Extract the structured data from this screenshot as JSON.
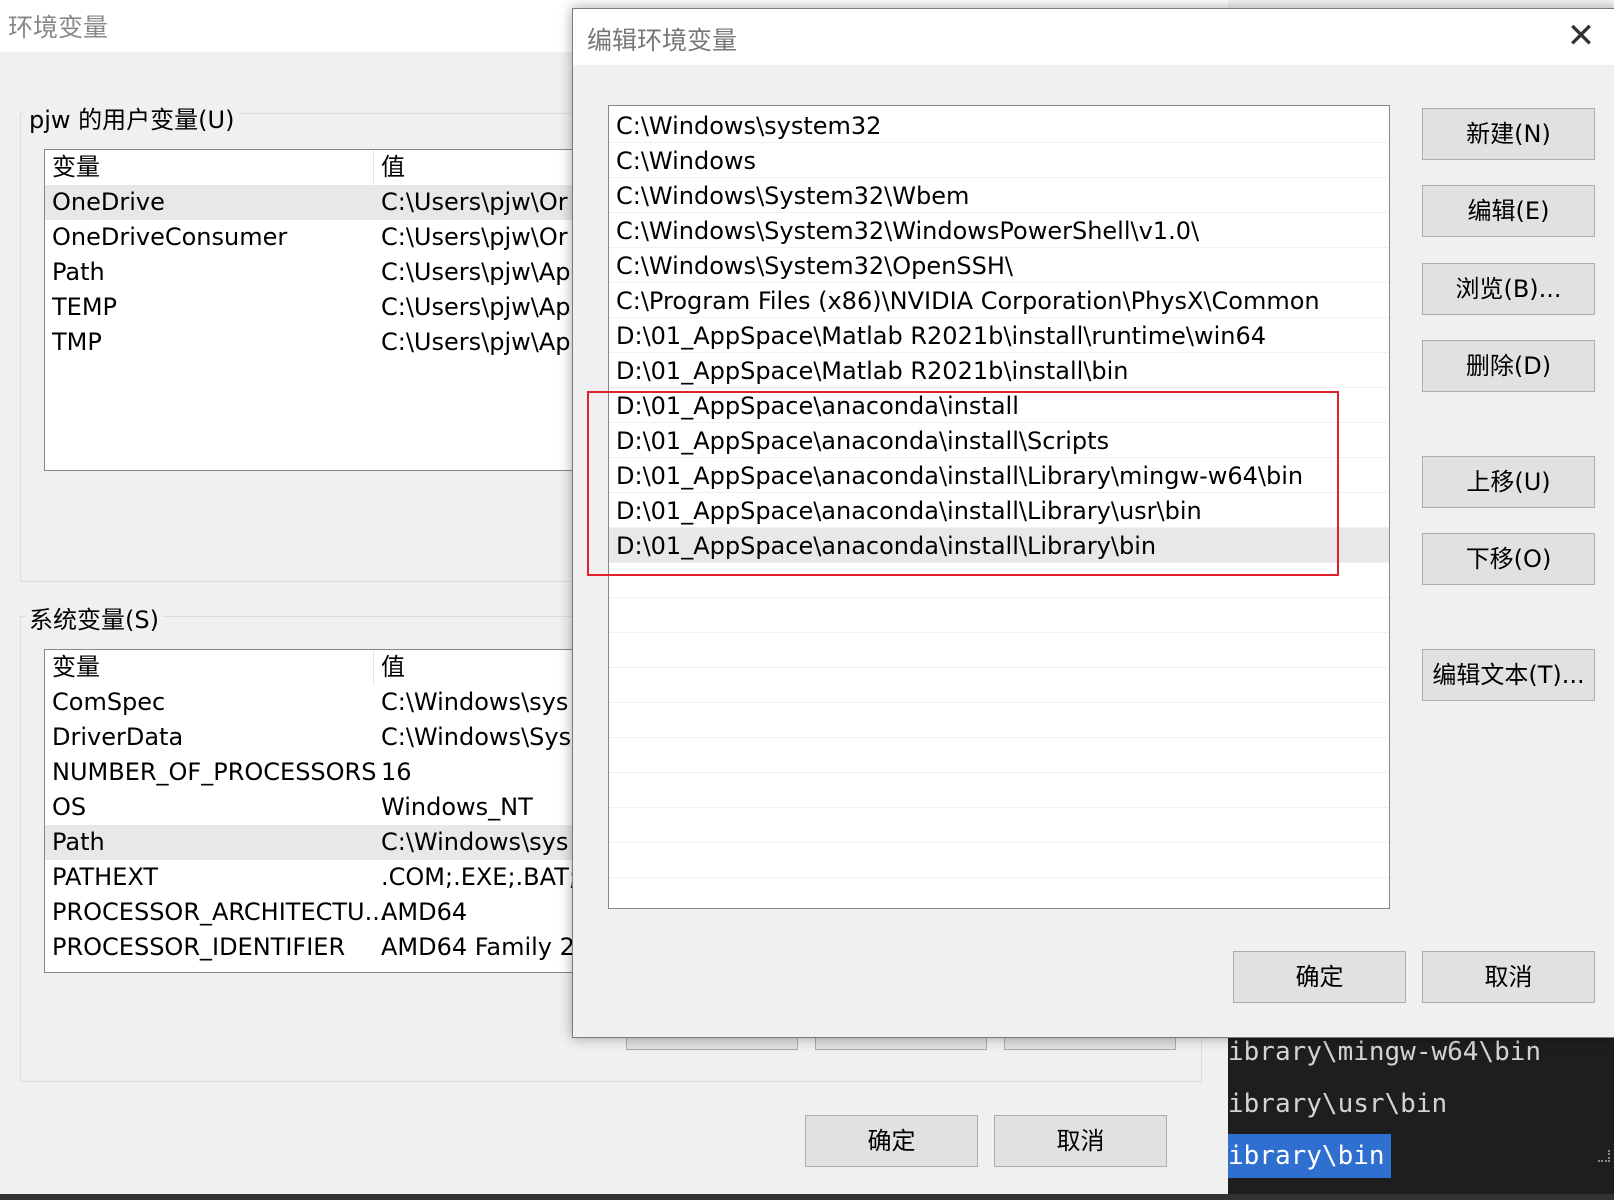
{
  "env_dialog": {
    "title": "环境变量",
    "user_group_label": "pjw 的用户变量(U)",
    "user_vars_header": {
      "name": "变量",
      "value": "值"
    },
    "user_vars": [
      {
        "name": "OneDrive",
        "value": "C:\\Users\\pjw\\Or"
      },
      {
        "name": "OneDriveConsumer",
        "value": "C:\\Users\\pjw\\Or"
      },
      {
        "name": "Path",
        "value": "C:\\Users\\pjw\\Ap"
      },
      {
        "name": "TEMP",
        "value": "C:\\Users\\pjw\\Ap"
      },
      {
        "name": "TMP",
        "value": "C:\\Users\\pjw\\Ap"
      }
    ],
    "system_group_label": "系统变量(S)",
    "system_vars_header": {
      "name": "变量",
      "value": "值"
    },
    "system_vars": [
      {
        "name": "ComSpec",
        "value": "C:\\Windows\\sys"
      },
      {
        "name": "DriverData",
        "value": "C:\\Windows\\Sys"
      },
      {
        "name": "NUMBER_OF_PROCESSORS",
        "value": "16"
      },
      {
        "name": "OS",
        "value": "Windows_NT"
      },
      {
        "name": "Path",
        "value": "C:\\Windows\\sys"
      },
      {
        "name": "PATHEXT",
        "value": ".COM;.EXE;.BAT;"
      },
      {
        "name": "PROCESSOR_ARCHITECTU...",
        "value": "AMD64"
      },
      {
        "name": "PROCESSOR_IDENTIFIER",
        "value": "AMD64 Family 2"
      }
    ],
    "ok_label": "确定",
    "cancel_label": "取消"
  },
  "edit_dialog": {
    "title": "编辑环境变量",
    "close_icon": "close-icon",
    "paths": [
      "C:\\Windows\\system32",
      "C:\\Windows",
      "C:\\Windows\\System32\\Wbem",
      "C:\\Windows\\System32\\WindowsPowerShell\\v1.0\\",
      "C:\\Windows\\System32\\OpenSSH\\",
      "C:\\Program Files (x86)\\NVIDIA Corporation\\PhysX\\Common",
      "D:\\01_AppSpace\\Matlab R2021b\\install\\runtime\\win64",
      "D:\\01_AppSpace\\Matlab R2021b\\install\\bin",
      "D:\\01_AppSpace\\anaconda\\install",
      "D:\\01_AppSpace\\anaconda\\install\\Scripts",
      "D:\\01_AppSpace\\anaconda\\install\\Library\\mingw-w64\\bin",
      "D:\\01_AppSpace\\anaconda\\install\\Library\\usr\\bin",
      "D:\\01_AppSpace\\anaconda\\install\\Library\\bin"
    ],
    "buttons": {
      "new": "新建(N)",
      "edit": "编辑(E)",
      "browse": "浏览(B)...",
      "delete": "删除(D)",
      "move_up": "上移(U)",
      "move_down": "下移(O)",
      "edit_text": "编辑文本(T)..."
    },
    "ok_label": "确定",
    "cancel_label": "取消",
    "highlight_color": "#e0202a"
  },
  "editor": {
    "lines": [
      "ibrary\\mingw-w64\\bin",
      "ibrary\\usr\\bin",
      "ibrary\\bin"
    ],
    "selection_color": "#2f6fcf"
  }
}
